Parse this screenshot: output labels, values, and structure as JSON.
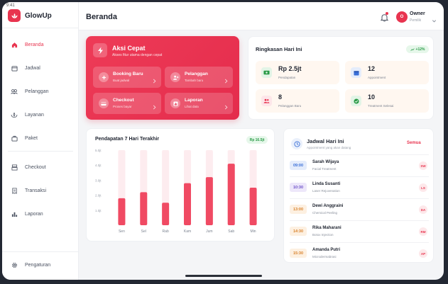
{
  "statusbar": {
    "time": "9:41"
  },
  "brand": {
    "name": "GlowUp"
  },
  "sidebar": {
    "items": [
      {
        "label": "Beranda",
        "icon": "home-icon",
        "active": true
      },
      {
        "label": "Jadwal",
        "icon": "calendar-icon",
        "active": false
      },
      {
        "label": "Pelanggan",
        "icon": "users-icon",
        "active": false
      },
      {
        "label": "Layanan",
        "icon": "lotus-icon",
        "active": false
      },
      {
        "label": "Paket",
        "icon": "package-icon",
        "active": false
      },
      {
        "label": "Checkout",
        "icon": "register-icon",
        "active": false
      },
      {
        "label": "Transaksi",
        "icon": "receipt-icon",
        "active": false
      },
      {
        "label": "Laporan",
        "icon": "bar-chart-icon",
        "active": false
      }
    ],
    "settings_label": "Pengaturan"
  },
  "header": {
    "title": "Beranda",
    "user": {
      "initial": "O",
      "name": "Owner",
      "role": "Pemilik"
    }
  },
  "quick_actions": {
    "title": "Aksi Cepat",
    "subtitle": "Akses fitur utama dengan cepat",
    "items": [
      {
        "label": "Booking Baru",
        "sub": "Buat jadwal",
        "icon": "plus-icon"
      },
      {
        "label": "Pelanggan",
        "sub": "Tambah baru",
        "icon": "add-user-icon"
      },
      {
        "label": "Checkout",
        "sub": "Proses bayar",
        "icon": "card-icon"
      },
      {
        "label": "Laporan",
        "sub": "Lihat data",
        "icon": "report-icon"
      }
    ]
  },
  "summary": {
    "title": "Ringkasan Hari Ini",
    "badge": "+12%",
    "stats": [
      {
        "value": "Rp 2.5jt",
        "label": "Pendapatan",
        "color": "#2a9b47",
        "bg": "#e2f4e6"
      },
      {
        "value": "12",
        "label": "Appointment",
        "color": "#3a6fd8",
        "bg": "#e4ecfb"
      },
      {
        "value": "8",
        "label": "Pelanggan Baru",
        "color": "#e8344f",
        "bg": "#fde6e9"
      },
      {
        "value": "10",
        "label": "Treatment Selesai",
        "color": "#2a9b47",
        "bg": "#e2f4e6"
      }
    ]
  },
  "revenue": {
    "title": "Pendapatan 7 Hari Terakhir",
    "badge": "Rp 16.5jt"
  },
  "chart_data": {
    "type": "bar",
    "categories": [
      "Sen",
      "Sel",
      "Rab",
      "Kam",
      "Jum",
      "Sab",
      "Min"
    ],
    "values": [
      1.8,
      2.2,
      1.5,
      2.8,
      3.2,
      4.1,
      2.5
    ],
    "ytick_labels": [
      "5.0jt",
      "4.0jt",
      "3.0jt",
      "2.0jt",
      "1.0jt"
    ],
    "ylim": [
      0,
      5
    ],
    "title": "Pendapatan 7 Hari Terakhir",
    "bar_color": "#f04a63",
    "track_color": "#fdecef"
  },
  "schedule": {
    "title": "Jadwal Hari Ini",
    "subtitle": "Appointment yang akan datang",
    "all_label": "Semua",
    "rows": [
      {
        "time": "09:00",
        "name": "Sarah Wijaya",
        "treatment": "Facial Treatment",
        "initials": "SW",
        "tone": "blue"
      },
      {
        "time": "10:30",
        "name": "Linda Susanti",
        "treatment": "Laser Rejuvenation",
        "initials": "LS",
        "tone": "purple"
      },
      {
        "time": "13:00",
        "name": "Dewi Anggraini",
        "treatment": "Chemical Peeling",
        "initials": "DA",
        "tone": "orange"
      },
      {
        "time": "14:30",
        "name": "Rika Maharani",
        "treatment": "Botox Injection",
        "initials": "RM",
        "tone": "orange"
      },
      {
        "time": "15:30",
        "name": "Amanda Putri",
        "treatment": "Microdermabrasi",
        "initials": "AP",
        "tone": "orange"
      }
    ]
  }
}
